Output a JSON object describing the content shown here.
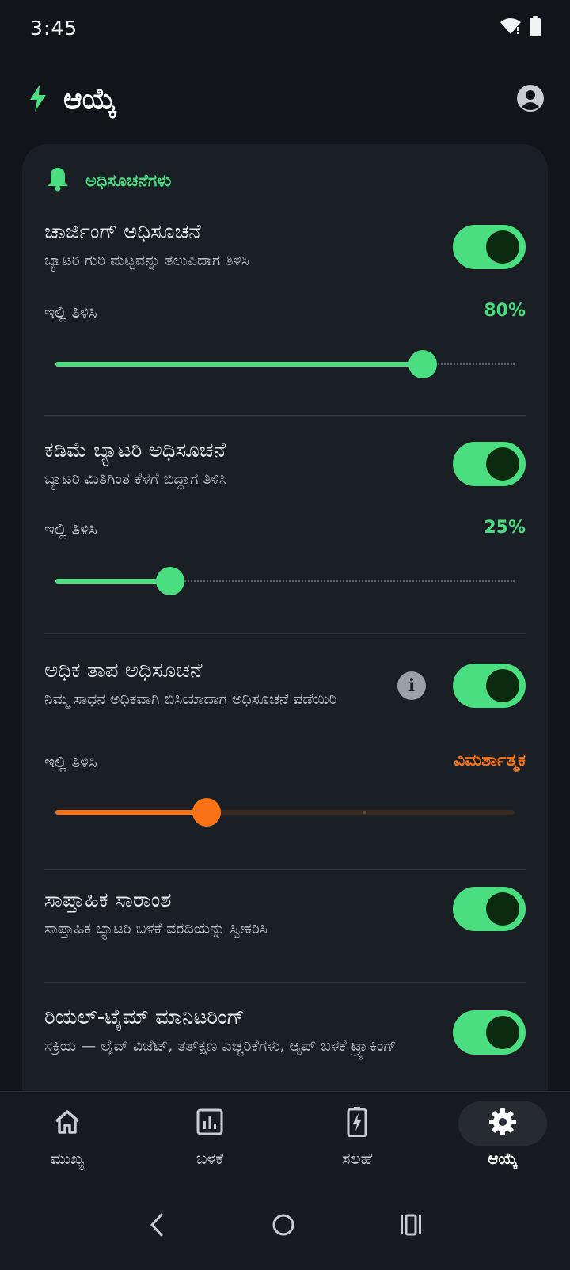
{
  "status_bar": {
    "time": "3:45"
  },
  "header": {
    "title": "ಆಯ್ಕೆ"
  },
  "section": {
    "title": "ಅಧಿಸೂಚನೆಗಳು"
  },
  "rows": [
    {
      "title": "ಚಾರ್ಜಿಂಗ್ ಅಧಿಸೂಚನೆ",
      "subtitle": "ಬ್ಯಾಟರಿ ಗುರಿ ಮಟ್ಟವನ್ನು ತಲುಪಿದಾಗ ತಿಳಿಸಿ",
      "enabled": true,
      "alert_label": "ಇಲ್ಲಿ ತಿಳಿಸಿ",
      "alert_value": "80%",
      "level": 0.8
    },
    {
      "title": "ಕಡಿಮೆ ಬ್ಯಾಟರಿ ಅಧಿಸೂಚನೆ",
      "subtitle": "ಬ್ಯಾಟರಿ ಮಿತಿಗಿಂತ ಕೆಳಗೆ ಬಿದ್ದಾಗ ತಿಳಿಸಿ",
      "enabled": true,
      "alert_label": "ಇಲ್ಲಿ ತಿಳಿಸಿ",
      "alert_value": "25%",
      "level": 0.25
    },
    {
      "title": "ಅಧಿಕ ತಾಪ ಅಧಿಸೂಚನೆ",
      "subtitle": "ನಿಮ್ಮ ಸಾಧನ ಅಧಿಕವಾಗಿ ಬಿಸಿಯಾದಾಗ ಅಧಿಸೂಚನೆ ಪಡೆಯಿರಿ",
      "enabled": true,
      "alert_label": "ಇಲ್ಲಿ ತಿಳಿಸಿ",
      "alert_value": "ವಿಮರ್ಶಾತ್ಮಕ",
      "level": 0.33,
      "color": "#f97316"
    },
    {
      "title": "ಸಾಪ್ತಾಹಿಕ ಸಾರಾಂಶ",
      "subtitle": "ಸಾಪ್ತಾಹಿಕ ಬ್ಯಾಟರಿ ಬಳಕೆ ವರದಿಯನ್ನು ಸ್ವೀಕರಿಸಿ",
      "enabled": true
    },
    {
      "title": "ರಿಯಲ್-ಟೈಮ್ ಮಾನಿಟರಿಂಗ್",
      "subtitle": "ಸಕ್ರಿಯ — ಲೈವ್ ವಿಜೆಟ್, ತತ್ಕ್ಷಣ ಎಚ್ಚರಿಕೆಗಳು, ಆ್ಯಪ್ ಬಳಕೆ ಟ್ರ್ಯಾಕಿಂಗ್",
      "enabled": true
    }
  ],
  "nav": {
    "items": [
      {
        "label": "ಮುಖ್ಯ",
        "icon": "home-icon"
      },
      {
        "label": "ಬಳಕೆ",
        "icon": "chart-icon"
      },
      {
        "label": "ಸಲಹೆ",
        "icon": "battery-bolt-icon"
      },
      {
        "label": "ಆಯ್ಕೆ",
        "icon": "gear-icon",
        "active": true
      }
    ]
  },
  "colors": {
    "accent": "#4ade80",
    "warning": "#f97316",
    "background": "#111419",
    "card": "#1a1f25"
  }
}
